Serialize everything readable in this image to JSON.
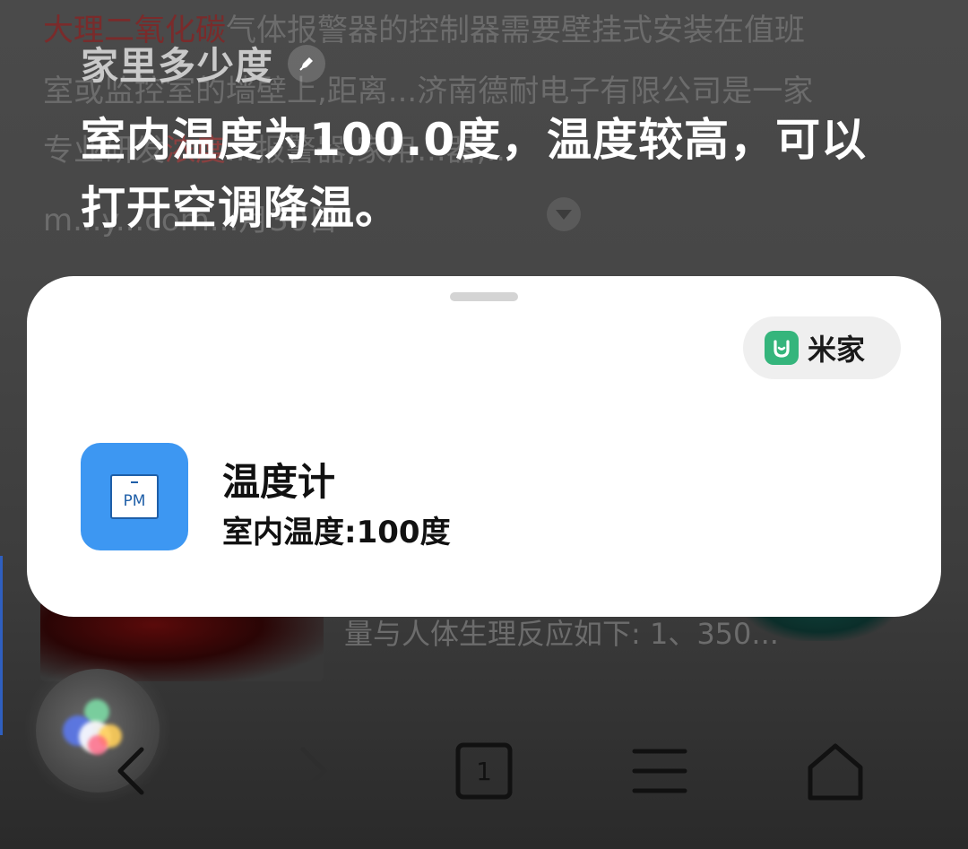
{
  "background_page": {
    "line1_keyword": "大理二氧化碳",
    "line1_rest": "气体报警器的控制器需要壁挂式安装在值班",
    "line2": "室或监控室的墙壁上,距离...济南德耐电子有限公司是一家",
    "line3_pre": "专业研发",
    "line3_kw": "浓度",
    "line3_post": "...报警器,家用...器,...",
    "line4": "m...y...com...月30日",
    "line5": "量与人体生理反应如下: 1、350..."
  },
  "assistant": {
    "query": "家里多少度",
    "answer": "室内温度为100.0度，温度较高，可以打开空调降温。"
  },
  "card": {
    "source_label": "米家",
    "device_icon_text": "PM",
    "device_name": "温度计",
    "device_status": "室内温度:100度"
  },
  "nav": {
    "tab_count": "1"
  },
  "icons": {
    "edit": "pencil-icon",
    "source": "mijia-logo-icon",
    "device": "pm-sensor-icon",
    "back": "chevron-left-icon",
    "forward": "chevron-right-icon",
    "tabs": "tabs-icon",
    "menu": "hamburger-menu-icon",
    "home": "home-icon"
  },
  "colors": {
    "mijia_green": "#35b57c",
    "device_blue": "#3d97f2",
    "card_bg": "#ffffff"
  }
}
